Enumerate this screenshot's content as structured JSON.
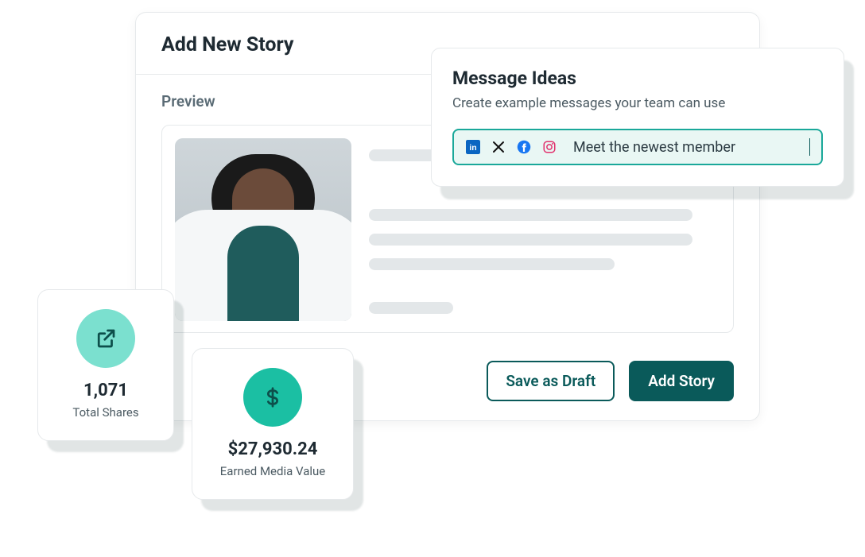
{
  "main": {
    "title": "Add New Story",
    "preview_label": "Preview",
    "buttons": {
      "draft": "Save as Draft",
      "add": "Add Story"
    }
  },
  "popover": {
    "title": "Message Ideas",
    "subtitle": "Create example messages your team can use",
    "social_icons": [
      "linkedin",
      "x",
      "facebook",
      "instagram"
    ],
    "input_text": "Meet the newest member"
  },
  "stats": {
    "shares": {
      "value": "1,071",
      "label": "Total Shares",
      "icon": "external-link"
    },
    "emv": {
      "value": "$27,930.24",
      "label": "Earned Media Value",
      "icon": "dollar"
    }
  }
}
